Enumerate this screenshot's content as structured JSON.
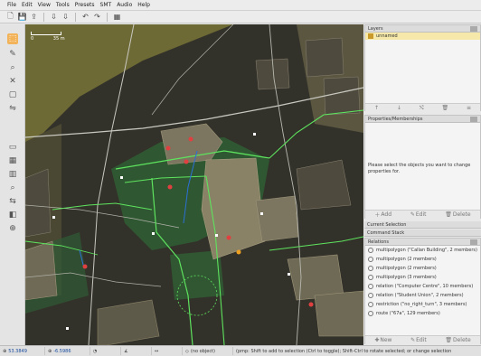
{
  "menubar": {
    "items": [
      "File",
      "Edit",
      "View",
      "Tools",
      "Presets",
      "SMT",
      "Audio",
      "Help"
    ]
  },
  "toolbar": {
    "icons": [
      "new-file-icon",
      "save-icon",
      "upload-icon",
      "download-icon",
      "download-icon",
      "undo-icon",
      "redo-icon",
      "preferences-icon"
    ],
    "glyphs": [
      "🗋",
      "💾",
      "⇪",
      "⇩",
      "⇩",
      "↶",
      "↷",
      "▦"
    ]
  },
  "left_tools": {
    "icons": [
      "select-icon",
      "draw-icon",
      "zoom-icon",
      "delete-icon",
      "extrude-icon",
      "parallel-icon",
      "sidebar-icon",
      "map-icon",
      "layer-icon",
      "search-icon",
      "connect-icon",
      "expert-icon",
      "filter-icon"
    ],
    "glyphs": [
      "⬚",
      "✎",
      "⌕",
      "✕",
      "▢",
      "⇋",
      "▭",
      "▦",
      "▥",
      "⌕",
      "⇆",
      "◧",
      "⊕"
    ]
  },
  "map": {
    "scale_label": "35 m",
    "scale_left_label": "0"
  },
  "layers": {
    "title": "Layers",
    "items": [
      {
        "name": "unnamed",
        "active": true
      }
    ]
  },
  "layers_buttons": [
    "↑",
    "↓",
    "⤭",
    "🗑",
    "≡"
  ],
  "properties": {
    "title": "Properties/Memberships",
    "message": "Please select the objects you want to change properties for.",
    "buttons": [
      {
        "icon": "add-icon",
        "label": "Add"
      },
      {
        "icon": "edit-icon",
        "label": "Edit"
      },
      {
        "icon": "delete-icon",
        "label": "Delete"
      }
    ]
  },
  "panels_collapsed": [
    {
      "title": "Current Selection"
    },
    {
      "title": "Command Stack"
    },
    {
      "title": "Relations"
    }
  ],
  "relations": {
    "items": [
      "multipolygon (\"Callan Building\", 2 members)",
      "multipolygon (2 members)",
      "multipolygon (2 members)",
      "multipolygon (3 members)",
      "relation (\"Computer Centre\", 10 members)",
      "relation (\"Student Union\", 2 members)",
      "restriction (\"no_right_turn\", 3 members)",
      "route (\"67a\", 129 members)"
    ],
    "buttons": [
      {
        "icon": "new-icon",
        "label": "New"
      },
      {
        "icon": "edit-icon",
        "label": "Edit"
      },
      {
        "icon": "delete-icon",
        "label": "Delete"
      }
    ]
  },
  "status": {
    "lat": "53.3849",
    "lon": "-6.5986",
    "heading_icon": "heading-icon",
    "angle_icon": "angle-icon",
    "distance_icon": "distance-icon",
    "object_label": "(no object)",
    "help": "(pmp: Shift to add to selection (Ctrl to toggle); Shift-Ctrl to rotate selected; or change selection"
  }
}
